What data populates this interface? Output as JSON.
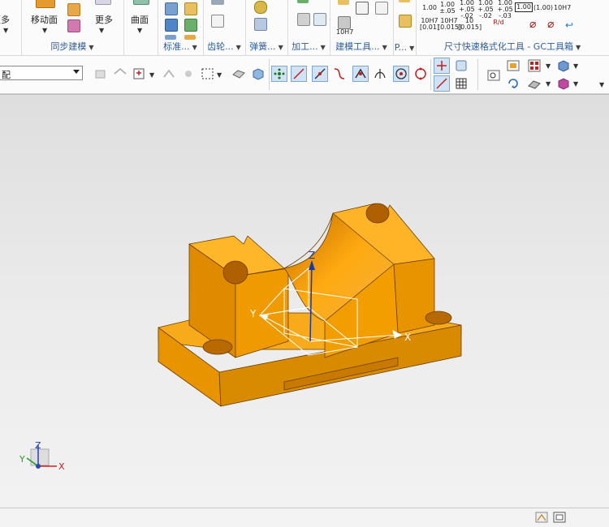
{
  "ribbon": {
    "cut_left_label": "更多",
    "move_face_label": "移动面",
    "more_label": "更多",
    "surface_label": "曲面",
    "groups": {
      "sync": "同步建模",
      "standard": "标准...",
      "gear": "齿轮...",
      "spring": "弹簧...",
      "machining": "加工...",
      "modeling_tools": "建模工具...",
      "p": "P...",
      "dimension": "尺寸快速格式化工具 - GC工具箱"
    },
    "tol": {
      "a": "1.00",
      "b1": "1.00",
      "b2": "±.05",
      "c1": "1.00",
      "c2": "+.05",
      "c3": "-.02",
      "d1": "1.00",
      "d2": "+.05",
      "d3": "-.02",
      "e1": "1.00",
      "e2": "+.05",
      "e3": "-.03",
      "f": "1.00",
      "g": "(1.00)",
      "h": "10H7",
      "i1": "10H7",
      "i2": "[0.01]",
      "j1": "10H7",
      "j2": "[0.015]",
      "k1": "10",
      "k2": "[0.015]",
      "l": "10H7",
      "r": "R/d"
    }
  },
  "toolbar": {
    "filter_combo_value": "配"
  },
  "viewport": {
    "axis_x": "X",
    "axis_y": "Y",
    "axis_z": "Z",
    "triad_x": "X",
    "triad_y": "Y",
    "triad_z": "Z",
    "part_color": "#f0a000"
  }
}
